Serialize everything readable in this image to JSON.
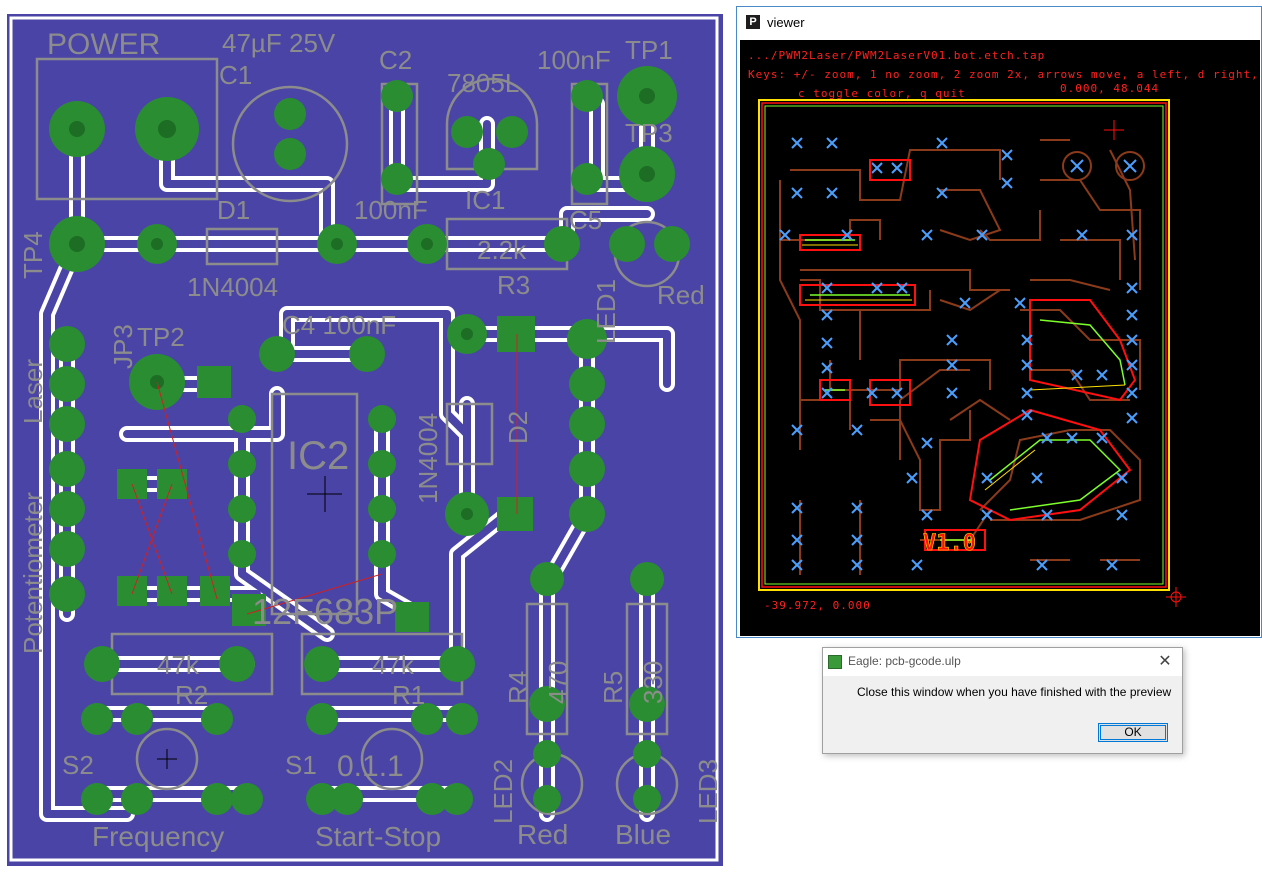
{
  "board": {
    "silkscreen": {
      "power": "POWER",
      "cap1_value": "47µF 25V",
      "c1": "C1",
      "c2": "C2",
      "c2_value": "100nF",
      "reg_value": "7805L",
      "c3_value": "100nF",
      "tp1": "TP1",
      "tp3": "TP3",
      "ic1": "IC1",
      "c5_value": "100nF",
      "c5": "C5",
      "d1": "D1",
      "d1_value": "1N4004",
      "r3_value": "2.2k",
      "r3": "R3",
      "led1": "LED1",
      "led1_color": "Red",
      "tp4": "TP4",
      "c4": "C4 100nF",
      "tp2": "TP2",
      "jp3": "JP3",
      "laser": "Laser",
      "ic2": "IC2",
      "d2_value": "1N4004",
      "d2": "D2",
      "potentiometer": "Potentiometer",
      "mcu": "12F683P",
      "r2_value": "47k",
      "r2": "R2",
      "r1_value": "47k",
      "r1": "R1",
      "r4": "R4",
      "r4_value": "470",
      "r5": "R5",
      "r5_value": "330",
      "s2": "S2",
      "s1": "S1",
      "version": "0.1.1",
      "led2": "LED2",
      "led3": "LED3",
      "frequency": "Frequency",
      "start_stop": "Start-Stop",
      "red": "Red",
      "blue": "Blue"
    },
    "colors": {
      "copper_fill": "#4a44a6",
      "pad": "#2a8d32",
      "silk": "#8c8c8c",
      "clearance": "#ffffff",
      "airwire": "#d02020"
    }
  },
  "viewer": {
    "title": "viewer",
    "path": ".../PWM2Laser/PWM2LaserV01.bot.etch.tap",
    "keys": "Keys: +/- zoom, 1 no zoom, 2 zoom 2x, arrows move, a left, d right,",
    "keys2": "c toggle color, q quit",
    "coord_top": "0.000, 48.044",
    "coord_bottom": "-39.972, 0.000",
    "board_label": "V1.0",
    "colors": {
      "background": "#000000",
      "text": "#ff2020",
      "path_brown": "#8b3a1a",
      "path_red": "#ff1010",
      "path_green": "#7dff2a",
      "path_yellow": "#ffe000",
      "drill": "#4aa0ff"
    }
  },
  "dialog": {
    "title": "Eagle: pcb-gcode.ulp",
    "message": "Close this window when you have finished with the preview",
    "ok_label": "OK"
  }
}
